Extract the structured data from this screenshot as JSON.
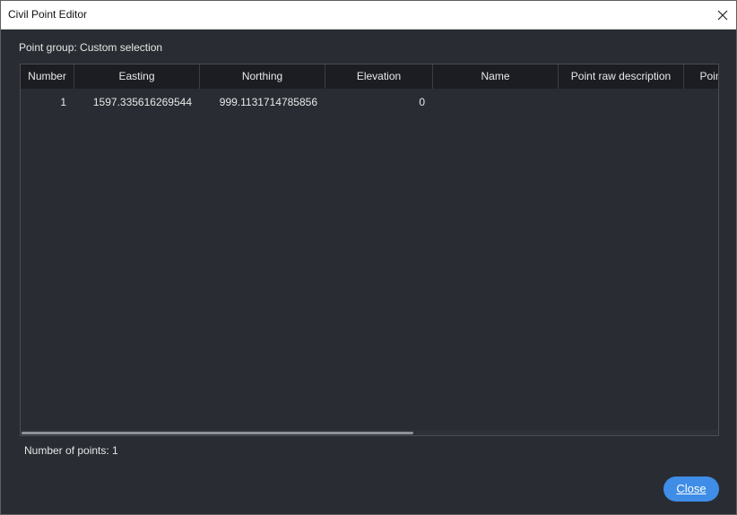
{
  "window": {
    "title": "Civil Point Editor"
  },
  "dialog": {
    "point_group": "Point group: Custom selection",
    "count_label": "Number of points: 1",
    "close_label": "Close"
  },
  "table": {
    "columns": [
      "Number",
      "Easting",
      "Northing",
      "Elevation",
      "Name",
      "Point raw description",
      "Poin"
    ],
    "rows": [
      {
        "number": "1",
        "easting": "1597.335616269544",
        "northing": "999.1131714785856",
        "elevation": "0",
        "name": "",
        "raw_description": "",
        "extra": ""
      }
    ]
  },
  "icons": {
    "close": "close-icon"
  }
}
